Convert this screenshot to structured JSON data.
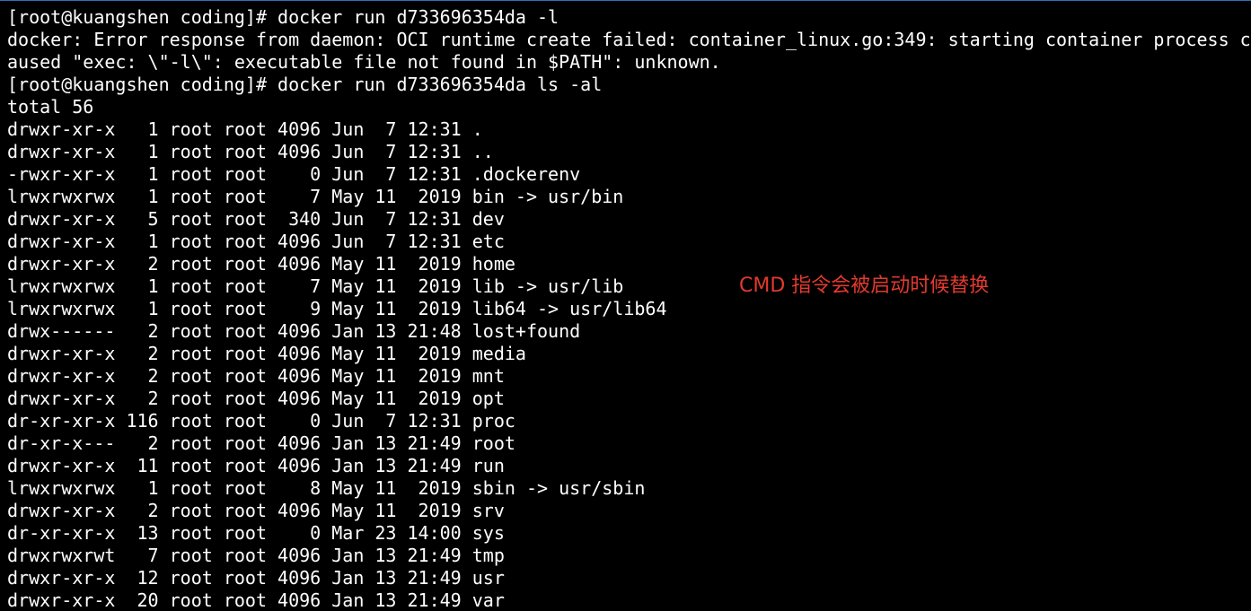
{
  "terminal": {
    "lines": [
      "[root@kuangshen coding]# docker run d733696354da -l",
      "docker: Error response from daemon: OCI runtime create failed: container_linux.go:349: starting container process c",
      "aused \"exec: \\\"-l\\\": executable file not found in $PATH\": unknown.",
      "[root@kuangshen coding]# docker run d733696354da ls -al",
      "total 56",
      "drwxr-xr-x   1 root root 4096 Jun  7 12:31 .",
      "drwxr-xr-x   1 root root 4096 Jun  7 12:31 ..",
      "-rwxr-xr-x   1 root root    0 Jun  7 12:31 .dockerenv",
      "lrwxrwxrwx   1 root root    7 May 11  2019 bin -> usr/bin",
      "drwxr-xr-x   5 root root  340 Jun  7 12:31 dev",
      "drwxr-xr-x   1 root root 4096 Jun  7 12:31 etc",
      "drwxr-xr-x   2 root root 4096 May 11  2019 home",
      "lrwxrwxrwx   1 root root    7 May 11  2019 lib -> usr/lib",
      "lrwxrwxrwx   1 root root    9 May 11  2019 lib64 -> usr/lib64",
      "drwx------   2 root root 4096 Jan 13 21:48 lost+found",
      "drwxr-xr-x   2 root root 4096 May 11  2019 media",
      "drwxr-xr-x   2 root root 4096 May 11  2019 mnt",
      "drwxr-xr-x   2 root root 4096 May 11  2019 opt",
      "dr-xr-xr-x 116 root root    0 Jun  7 12:31 proc",
      "dr-xr-x---   2 root root 4096 Jan 13 21:49 root",
      "drwxr-xr-x  11 root root 4096 Jan 13 21:49 run",
      "lrwxrwxrwx   1 root root    8 May 11  2019 sbin -> usr/sbin",
      "drwxr-xr-x   2 root root 4096 May 11  2019 srv",
      "dr-xr-xr-x  13 root root    0 Mar 23 14:00 sys",
      "drwxrwxrwt   7 root root 4096 Jan 13 21:49 tmp",
      "drwxr-xr-x  12 root root 4096 Jan 13 21:49 usr",
      "drwxr-xr-x  20 root root 4096 Jan 13 21:49 var"
    ]
  },
  "annotation": {
    "text": "CMD 指令会被启动时候替换"
  },
  "colors": {
    "background": "#000000",
    "text": "#ffffff",
    "annotation": "#e23a2e"
  }
}
